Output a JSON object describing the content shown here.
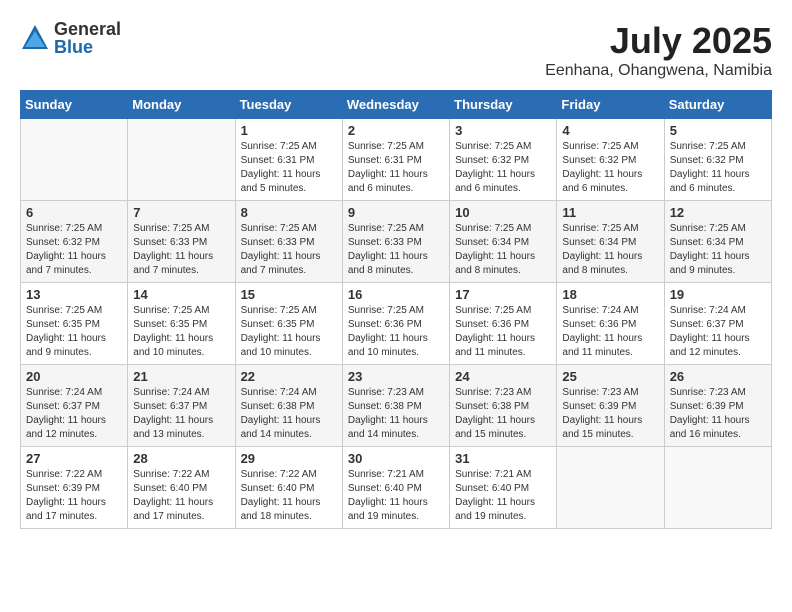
{
  "logo": {
    "general": "General",
    "blue": "Blue"
  },
  "title": {
    "month_year": "July 2025",
    "location": "Eenhana, Ohangwena, Namibia"
  },
  "weekdays": [
    "Sunday",
    "Monday",
    "Tuesday",
    "Wednesday",
    "Thursday",
    "Friday",
    "Saturday"
  ],
  "weeks": [
    [
      {
        "day": "",
        "detail": ""
      },
      {
        "day": "",
        "detail": ""
      },
      {
        "day": "1",
        "detail": "Sunrise: 7:25 AM\nSunset: 6:31 PM\nDaylight: 11 hours and 5 minutes."
      },
      {
        "day": "2",
        "detail": "Sunrise: 7:25 AM\nSunset: 6:31 PM\nDaylight: 11 hours and 6 minutes."
      },
      {
        "day": "3",
        "detail": "Sunrise: 7:25 AM\nSunset: 6:32 PM\nDaylight: 11 hours and 6 minutes."
      },
      {
        "day": "4",
        "detail": "Sunrise: 7:25 AM\nSunset: 6:32 PM\nDaylight: 11 hours and 6 minutes."
      },
      {
        "day": "5",
        "detail": "Sunrise: 7:25 AM\nSunset: 6:32 PM\nDaylight: 11 hours and 6 minutes."
      }
    ],
    [
      {
        "day": "6",
        "detail": "Sunrise: 7:25 AM\nSunset: 6:32 PM\nDaylight: 11 hours and 7 minutes."
      },
      {
        "day": "7",
        "detail": "Sunrise: 7:25 AM\nSunset: 6:33 PM\nDaylight: 11 hours and 7 minutes."
      },
      {
        "day": "8",
        "detail": "Sunrise: 7:25 AM\nSunset: 6:33 PM\nDaylight: 11 hours and 7 minutes."
      },
      {
        "day": "9",
        "detail": "Sunrise: 7:25 AM\nSunset: 6:33 PM\nDaylight: 11 hours and 8 minutes."
      },
      {
        "day": "10",
        "detail": "Sunrise: 7:25 AM\nSunset: 6:34 PM\nDaylight: 11 hours and 8 minutes."
      },
      {
        "day": "11",
        "detail": "Sunrise: 7:25 AM\nSunset: 6:34 PM\nDaylight: 11 hours and 8 minutes."
      },
      {
        "day": "12",
        "detail": "Sunrise: 7:25 AM\nSunset: 6:34 PM\nDaylight: 11 hours and 9 minutes."
      }
    ],
    [
      {
        "day": "13",
        "detail": "Sunrise: 7:25 AM\nSunset: 6:35 PM\nDaylight: 11 hours and 9 minutes."
      },
      {
        "day": "14",
        "detail": "Sunrise: 7:25 AM\nSunset: 6:35 PM\nDaylight: 11 hours and 10 minutes."
      },
      {
        "day": "15",
        "detail": "Sunrise: 7:25 AM\nSunset: 6:35 PM\nDaylight: 11 hours and 10 minutes."
      },
      {
        "day": "16",
        "detail": "Sunrise: 7:25 AM\nSunset: 6:36 PM\nDaylight: 11 hours and 10 minutes."
      },
      {
        "day": "17",
        "detail": "Sunrise: 7:25 AM\nSunset: 6:36 PM\nDaylight: 11 hours and 11 minutes."
      },
      {
        "day": "18",
        "detail": "Sunrise: 7:24 AM\nSunset: 6:36 PM\nDaylight: 11 hours and 11 minutes."
      },
      {
        "day": "19",
        "detail": "Sunrise: 7:24 AM\nSunset: 6:37 PM\nDaylight: 11 hours and 12 minutes."
      }
    ],
    [
      {
        "day": "20",
        "detail": "Sunrise: 7:24 AM\nSunset: 6:37 PM\nDaylight: 11 hours and 12 minutes."
      },
      {
        "day": "21",
        "detail": "Sunrise: 7:24 AM\nSunset: 6:37 PM\nDaylight: 11 hours and 13 minutes."
      },
      {
        "day": "22",
        "detail": "Sunrise: 7:24 AM\nSunset: 6:38 PM\nDaylight: 11 hours and 14 minutes."
      },
      {
        "day": "23",
        "detail": "Sunrise: 7:23 AM\nSunset: 6:38 PM\nDaylight: 11 hours and 14 minutes."
      },
      {
        "day": "24",
        "detail": "Sunrise: 7:23 AM\nSunset: 6:38 PM\nDaylight: 11 hours and 15 minutes."
      },
      {
        "day": "25",
        "detail": "Sunrise: 7:23 AM\nSunset: 6:39 PM\nDaylight: 11 hours and 15 minutes."
      },
      {
        "day": "26",
        "detail": "Sunrise: 7:23 AM\nSunset: 6:39 PM\nDaylight: 11 hours and 16 minutes."
      }
    ],
    [
      {
        "day": "27",
        "detail": "Sunrise: 7:22 AM\nSunset: 6:39 PM\nDaylight: 11 hours and 17 minutes."
      },
      {
        "day": "28",
        "detail": "Sunrise: 7:22 AM\nSunset: 6:40 PM\nDaylight: 11 hours and 17 minutes."
      },
      {
        "day": "29",
        "detail": "Sunrise: 7:22 AM\nSunset: 6:40 PM\nDaylight: 11 hours and 18 minutes."
      },
      {
        "day": "30",
        "detail": "Sunrise: 7:21 AM\nSunset: 6:40 PM\nDaylight: 11 hours and 19 minutes."
      },
      {
        "day": "31",
        "detail": "Sunrise: 7:21 AM\nSunset: 6:40 PM\nDaylight: 11 hours and 19 minutes."
      },
      {
        "day": "",
        "detail": ""
      },
      {
        "day": "",
        "detail": ""
      }
    ]
  ]
}
